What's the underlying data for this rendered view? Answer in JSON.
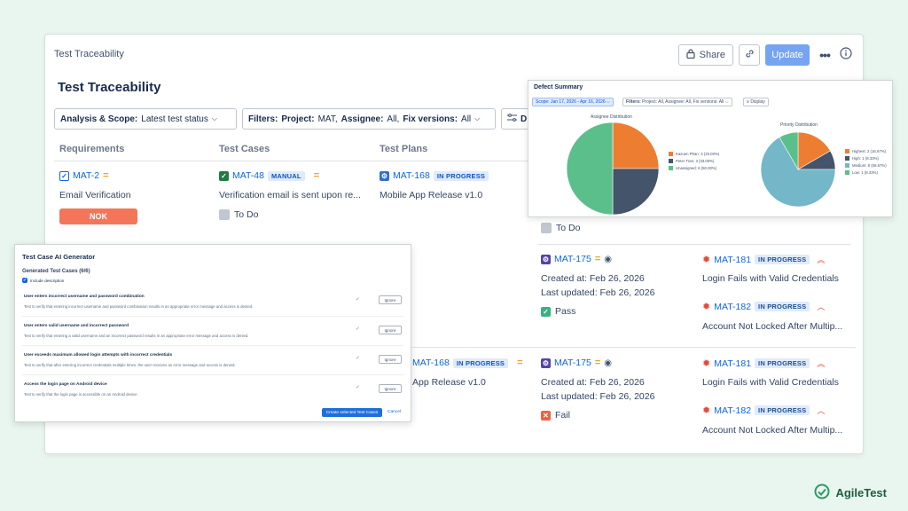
{
  "window": {
    "title": "Test Traceability",
    "share_label": "Share",
    "update_label": "Update",
    "page_title": "Test Traceability"
  },
  "filters": {
    "analysis_label": "Analysis & Scope:",
    "analysis_value": "Latest test status",
    "filters_label": "Filters:",
    "project_label": "Project:",
    "project_value": "MAT,",
    "assignee_label": "Assignee:",
    "assignee_value": "All,",
    "fix_label": "Fix versions:",
    "fix_value": "All",
    "display_partial": "D"
  },
  "columns": {
    "requirements": "Requirements",
    "test_cases": "Test Cases",
    "test_plans": "Test Plans"
  },
  "row1": {
    "req_key": "MAT-2",
    "req_title": "Email Verification",
    "req_status": "NOK",
    "tc_key": "MAT-48",
    "tc_badge": "MANUAL",
    "tc_title": "Verification email is sent upon re...",
    "tc_status": "To Do",
    "plan_key": "MAT-168",
    "plan_badge": "IN PROGRESS",
    "plan_title": "Mobile App Release v1.0",
    "exec_status": "To Do"
  },
  "row2": {
    "exec_key": "MAT-175",
    "created": "Created at: Feb 26, 2026",
    "updated": "Last updated: Feb 26, 2026",
    "result": "Pass",
    "defects": [
      {
        "key": "MAT-181",
        "badge": "IN PROGRESS",
        "title": "Login Fails with Valid Credentials"
      },
      {
        "key": "MAT-182",
        "badge": "IN PROGRESS",
        "title": "Account Not Locked After Multip..."
      }
    ]
  },
  "row3": {
    "plan_key": "MAT-168",
    "plan_badge": "IN PROGRESS",
    "plan_title": "App Release v1.0",
    "exec_key": "MAT-175",
    "created": "Created at: Feb 26, 2026",
    "updated": "Last updated: Feb 26, 2026",
    "result": "Fail",
    "defects": [
      {
        "key": "MAT-181",
        "badge": "IN PROGRESS",
        "title": "Login Fails with Valid Credentials"
      },
      {
        "key": "MAT-182",
        "badge": "IN PROGRESS",
        "title": "Account Not Locked After Multip..."
      }
    ]
  },
  "defect_summary": {
    "title": "Defect Summary",
    "scope": "Scope: Jan 17, 2026 - Apr 16, 2026",
    "filters_label": "Filters:",
    "filters_value": "Project: All, Assignee: All, Fix versions: All",
    "display": "Display"
  },
  "chart_data": [
    {
      "type": "pie",
      "title": "Assignee Distribution",
      "labels": [
        "Kazuen Phan: 3 (33.00%)",
        "Peter Tran: 3 (33.00%)",
        "Unassigned: 6 (50.00%)"
      ],
      "values": [
        3,
        3,
        6
      ],
      "colors": [
        "#ed7d31",
        "#44546a",
        "#5bbf8c"
      ]
    },
    {
      "type": "pie",
      "title": "Priority Distribution",
      "labels": [
        "Highest: 2 (16.67%)",
        "High: 1 (8.33%)",
        "Medium: 8 (66.67%)",
        "Low: 1 (8.33%)"
      ],
      "values": [
        2,
        1,
        8,
        1
      ],
      "colors": [
        "#ed7d31",
        "#44546a",
        "#73b7c9",
        "#5bbf8c"
      ]
    }
  ],
  "ai_generator": {
    "title": "Test Case AI Generator",
    "subtitle": "Generated Test Cases (6/6)",
    "include_description": "Include description",
    "items": [
      {
        "title": "User enters incorrect username and password combination",
        "desc": "Test to verify that entering incorrect username and password combination results in an appropriate error message and access is denied.",
        "ignore": "Ignore"
      },
      {
        "title": "User enters valid username and incorrect password",
        "desc": "Test to verify that entering a valid username and an incorrect password results in an appropriate error message and access is denied.",
        "ignore": "Ignore"
      },
      {
        "title": "User exceeds maximum allowed login attempts with incorrect credentials",
        "desc": "Test to verify that after entering incorrect credentials multiple times, the user receives an error message and access is denied.",
        "ignore": "Ignore"
      },
      {
        "title": "Access the login page on Android device",
        "desc": "Test to verify that the login page is accessible on an Android device.",
        "ignore": "Ignore"
      }
    ],
    "create_label": "Create selected Test Cases",
    "cancel_label": "Cancel"
  },
  "brand": {
    "name": "AgileTest"
  },
  "colors": {
    "accent": "#0c66e4",
    "nok": "#f47659",
    "pass": "#36b37e",
    "fail": "#f0623f"
  }
}
